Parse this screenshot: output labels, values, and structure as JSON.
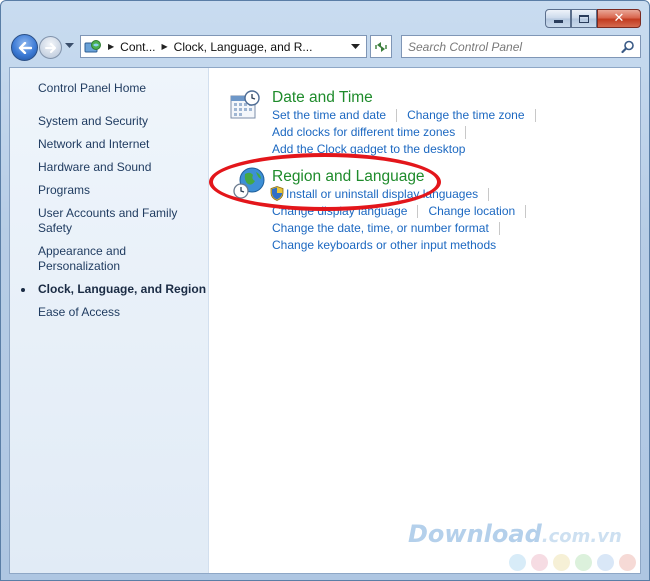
{
  "window": {
    "buttons": {
      "minimize": "minimize",
      "maximize": "maximize",
      "close": "close"
    }
  },
  "navbar": {
    "breadcrumbs": [
      "Cont...",
      "Clock, Language, and R..."
    ],
    "search_placeholder": "Search Control Panel"
  },
  "sidebar": {
    "home": "Control Panel Home",
    "items": [
      {
        "label": "System and Security",
        "active": false
      },
      {
        "label": "Network and Internet",
        "active": false
      },
      {
        "label": "Hardware and Sound",
        "active": false
      },
      {
        "label": "Programs",
        "active": false
      },
      {
        "label": "User Accounts and Family Safety",
        "active": false
      },
      {
        "label": "Appearance and Personalization",
        "active": false
      },
      {
        "label": "Clock, Language, and Region",
        "active": true
      },
      {
        "label": "Ease of Access",
        "active": false
      }
    ]
  },
  "categories": {
    "date_time": {
      "title": "Date and Time",
      "links": [
        "Set the time and date",
        "Change the time zone",
        "Add clocks for different time zones",
        "Add the Clock gadget to the desktop"
      ]
    },
    "region_language": {
      "title": "Region and Language",
      "links": [
        "Install or uninstall display languages",
        "Change display language",
        "Change location",
        "Change the date, time, or number format",
        "Change keyboards or other input methods"
      ]
    }
  },
  "watermark": {
    "name": "Download",
    "tld": ".com.vn"
  },
  "colors": {
    "category_title": "#1e8b2b",
    "link": "#1c68c1",
    "highlight_ring": "#e3161b",
    "dot_colors": [
      "#d8ecf8",
      "#f6dce3",
      "#f6f0d6",
      "#dcf1dc",
      "#d9e7f7",
      "#f6dad6"
    ]
  }
}
